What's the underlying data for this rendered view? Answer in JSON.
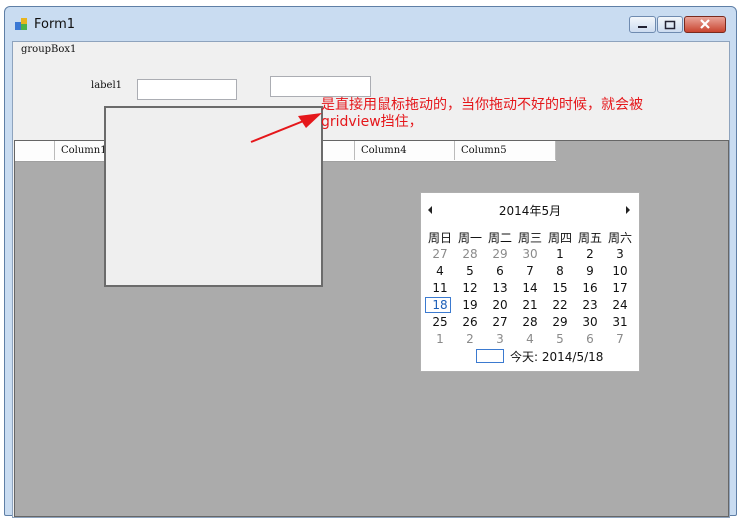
{
  "window": {
    "title": "Form1"
  },
  "group_box": {
    "label": "groupBox1"
  },
  "form": {
    "label1": "label1",
    "textbox1_value": "",
    "textbox2_value": ""
  },
  "grid": {
    "columns": [
      "Column1",
      "Column4",
      "Column5"
    ]
  },
  "annotation": {
    "line1": "是直接用鼠标拖动的，当你拖动不好的时候，就会被",
    "line2": "gridview挡住，",
    "color": "#e5171b"
  },
  "calendar": {
    "month_label": "2014年5月",
    "weekdays": [
      "周日",
      "周一",
      "周二",
      "周三",
      "周四",
      "周五",
      "周六"
    ],
    "rows": [
      [
        "27",
        "28",
        "29",
        "30",
        "1",
        "2",
        "3"
      ],
      [
        "4",
        "5",
        "6",
        "7",
        "8",
        "9",
        "10"
      ],
      [
        "11",
        "12",
        "13",
        "14",
        "15",
        "16",
        "17"
      ],
      [
        "18",
        "19",
        "20",
        "21",
        "22",
        "23",
        "24"
      ],
      [
        "25",
        "26",
        "27",
        "28",
        "29",
        "30",
        "31"
      ],
      [
        "1",
        "2",
        "3",
        "4",
        "5",
        "6",
        "7"
      ]
    ],
    "today_label": "今天: 2014/5/18",
    "selected_day": "18"
  }
}
